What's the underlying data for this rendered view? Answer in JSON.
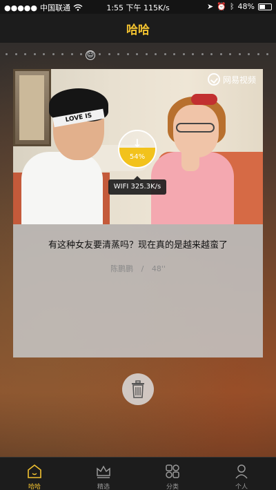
{
  "status_bar": {
    "signal": "●●●●●",
    "carrier": "中国联通",
    "wifi_icon": "wifi-icon",
    "time_speed": "1:55 下午 115K/s",
    "battery": "48%"
  },
  "header": {
    "title": "哈哈"
  },
  "video_card": {
    "watermark": "网易视频",
    "headband_text": "LOVE IS",
    "download_progress": {
      "percent_label": "54%",
      "value": 0.54
    },
    "speed_tooltip": "WIFI 325.3K/s",
    "title": "有这种女友要清蒸吗？现在真的是越来越蛮了",
    "author": "陈鹏鹏",
    "separator": "/",
    "duration": "48''"
  },
  "actions": {
    "delete_icon": "trash-icon"
  },
  "tabbar": {
    "tabs": [
      {
        "label": "哈哈",
        "icon": "home-icon",
        "active": true
      },
      {
        "label": "精选",
        "icon": "crown-icon",
        "active": false
      },
      {
        "label": "分类",
        "icon": "grid-icon",
        "active": false
      },
      {
        "label": "个人",
        "icon": "person-icon",
        "active": false
      }
    ]
  },
  "colors": {
    "accent": "#f2c230",
    "progress": "#f2c21c",
    "bar_bg": "#1c1c1c"
  }
}
